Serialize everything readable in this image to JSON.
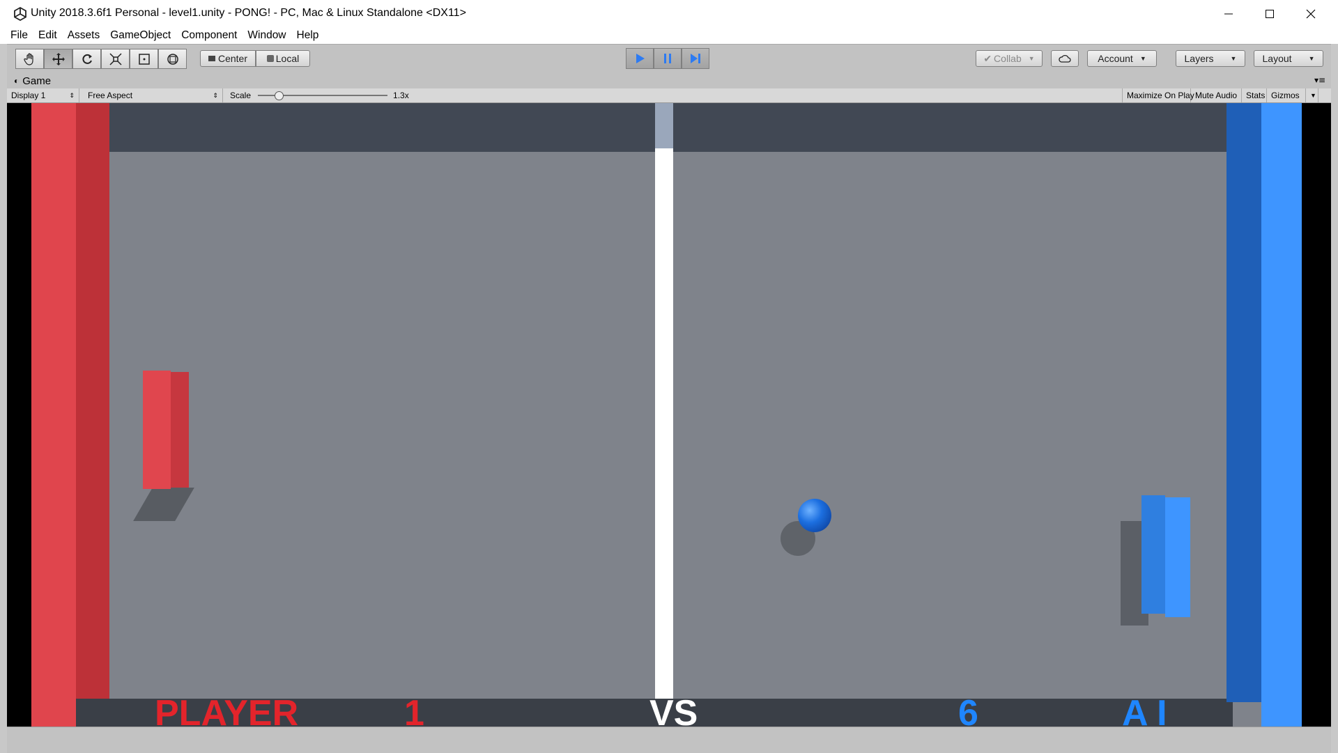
{
  "window": {
    "title": "Unity 2018.3.6f1 Personal - level1.unity - PONG! - PC, Mac & Linux Standalone <DX11>",
    "controls": {
      "minimize": "—",
      "maximize": "☐",
      "close": "✕"
    }
  },
  "menu": [
    "File",
    "Edit",
    "Assets",
    "GameObject",
    "Component",
    "Window",
    "Help"
  ],
  "toolbar": {
    "tools": [
      "hand-tool",
      "move-tool",
      "rotate-tool",
      "scale-tool",
      "rect-tool",
      "transform-tool"
    ],
    "pivot_label": "Center",
    "space_label": "Local",
    "play_state": "playing",
    "collab_label": "Collab",
    "account_label": "Account",
    "layers_label": "Layers",
    "layout_label": "Layout"
  },
  "game_panel": {
    "tab_label": "Game",
    "display": "Display 1",
    "aspect": "Free Aspect",
    "scale_label": "Scale",
    "scale_value": "1.3x",
    "maximize_on_play": "Maximize On Play",
    "mute_audio": "Mute Audio",
    "stats": "Stats",
    "gizmos": "Gizmos"
  },
  "scoreboard": {
    "player_label": "PLAYER",
    "player_score": "1",
    "vs_label": "VS",
    "ai_score": "6",
    "ai_label": "A I"
  },
  "colors": {
    "player": "#e3242b",
    "ai": "#1f86ff",
    "vs": "#ffffff",
    "play_active": "#2d7bf2"
  }
}
